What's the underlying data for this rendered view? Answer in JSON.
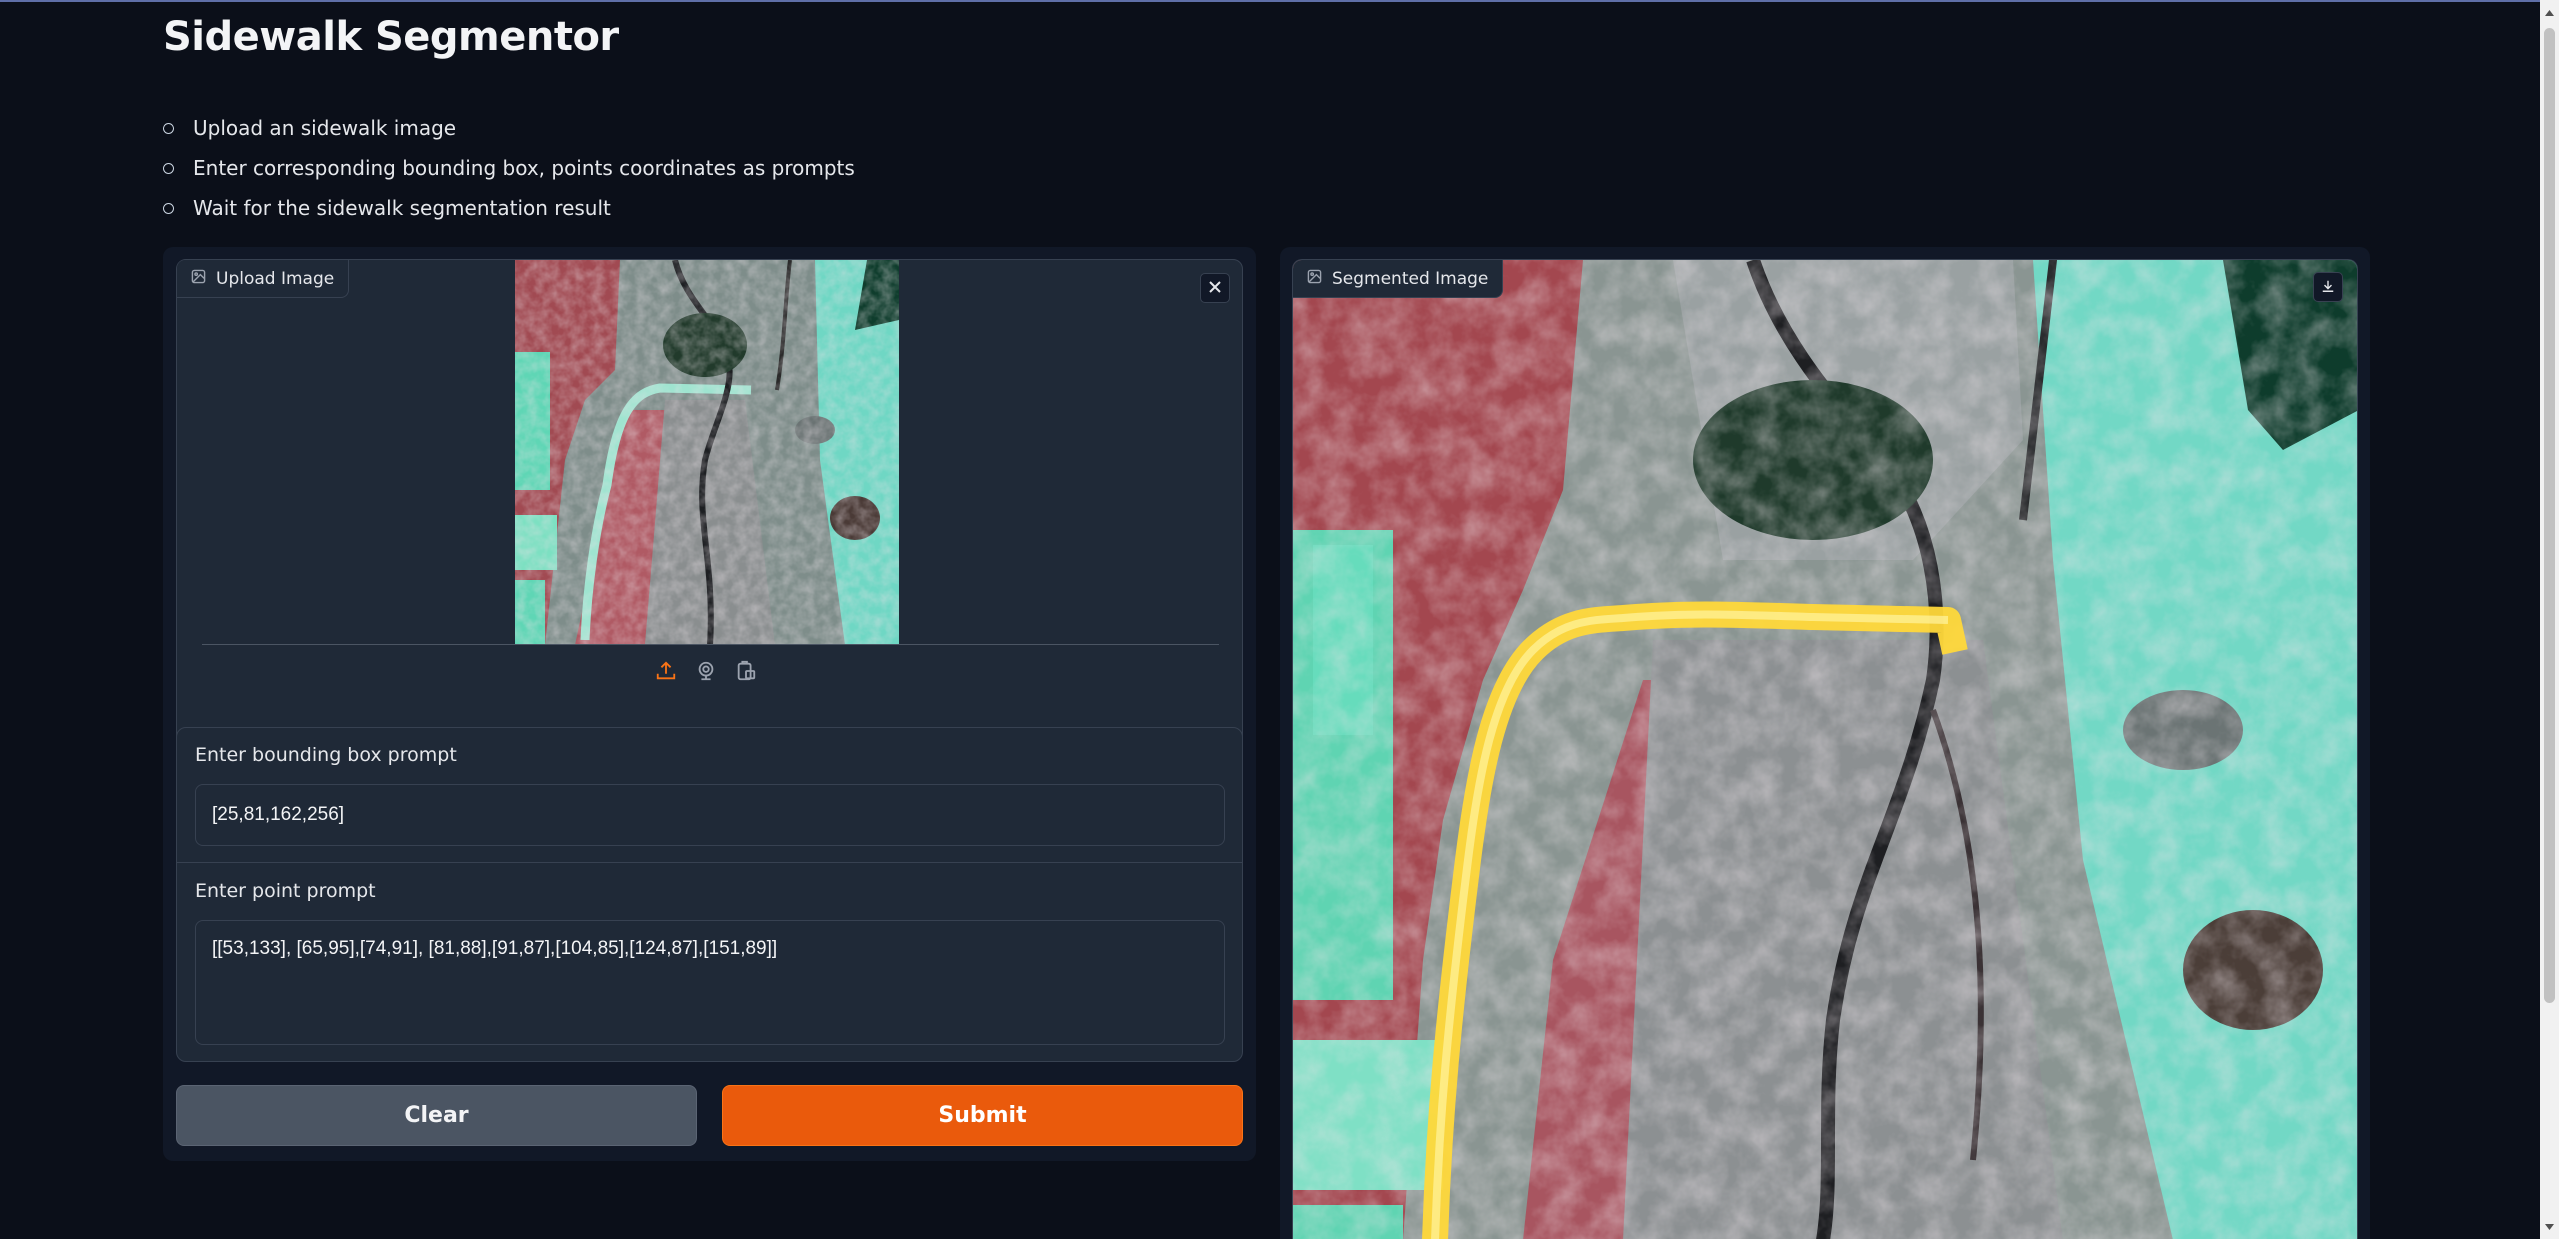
{
  "app": {
    "title": "Sidewalk Segmentor",
    "steps": [
      "Upload an sidewalk image",
      "Enter corresponding bounding box, points coordinates as prompts",
      "Wait for the sidewalk segmentation result"
    ]
  },
  "upload": {
    "label": "Upload Image",
    "label_icon": "image-icon",
    "close_icon": "close-icon",
    "source_icons": [
      "upload-icon",
      "webcam-icon",
      "clipboard-icon"
    ]
  },
  "bbox_prompt": {
    "label": "Enter bounding box prompt",
    "value": "[25,81,162,256]"
  },
  "point_prompt": {
    "label": "Enter point prompt",
    "value": "[[53,133], [65,95],[74,91], [81,88],[91,87],[104,85],[124,87],[151,89]]"
  },
  "buttons": {
    "clear": "Clear",
    "submit": "Submit"
  },
  "output": {
    "label": "Segmented Image",
    "label_icon": "image-icon",
    "download_icon": "download-icon"
  },
  "colors": {
    "background": "#0b0f19",
    "panel": "#1f2937",
    "accent": "#ea5a0c",
    "mask": "#ffd93a"
  }
}
